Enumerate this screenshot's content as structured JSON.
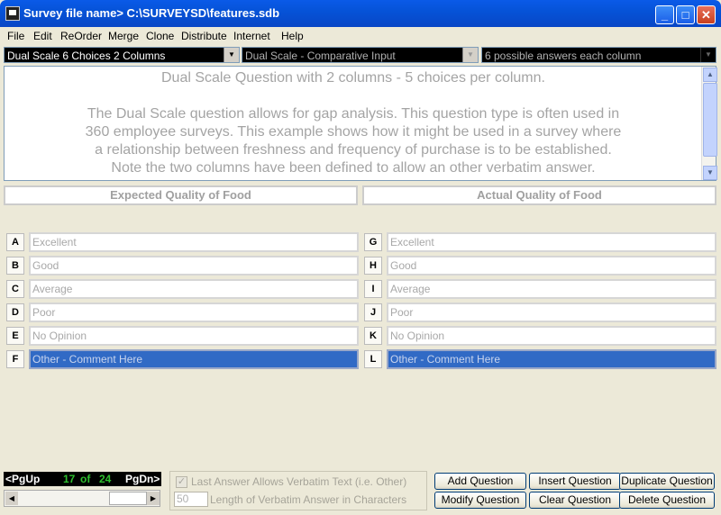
{
  "window": {
    "title": "Survey file name> C:\\SURVEYSD\\features.sdb",
    "minimize_glyph": "_",
    "maximize_glyph": "□",
    "close_glyph": "✕"
  },
  "menu": [
    "File",
    "Edit",
    "ReOrder",
    "Merge",
    "Clone",
    "Distribute",
    "Internet",
    "Help"
  ],
  "toolbar": {
    "question_select": "Dual Scale 6 Choices 2 Columns",
    "input_type_select": "Dual Scale - Comparative Input",
    "answers_select": "6 possible answers each column"
  },
  "question_text": {
    "lines": [
      "Dual Scale Question with 2 columns - 5 choices per column.",
      "",
      "The Dual Scale question allows for gap analysis. This question type is often used in",
      "360 employee surveys. This example shows how it might be used in a survey where",
      "a relationship between freshness and frequency of purchase is to be established.",
      "Note the two columns have been defined to allow an other verbatim answer."
    ]
  },
  "columns": [
    {
      "header": "Expected Quality of Food",
      "rows": [
        {
          "letter": "A",
          "text": "Excellent"
        },
        {
          "letter": "B",
          "text": "Good"
        },
        {
          "letter": "C",
          "text": "Average"
        },
        {
          "letter": "D",
          "text": "Poor"
        },
        {
          "letter": "E",
          "text": "No Opinion"
        },
        {
          "letter": "F",
          "text": "Other - Comment Here"
        }
      ]
    },
    {
      "header": "Actual Quality of Food",
      "rows": [
        {
          "letter": "G",
          "text": "Excellent"
        },
        {
          "letter": "H",
          "text": "Good"
        },
        {
          "letter": "I",
          "text": "Average"
        },
        {
          "letter": "J",
          "text": "Poor"
        },
        {
          "letter": "K",
          "text": "No Opinion"
        },
        {
          "letter": "L",
          "text": "Other - Comment Here"
        }
      ]
    }
  ],
  "pager": {
    "prev": "<PgUp",
    "current": "17",
    "of": "of",
    "total": "24",
    "next": "PgDn>"
  },
  "verbatim": {
    "checkbox_label": "Last Answer Allows Verbatim Text (i.e. Other)",
    "checked_glyph": "✓",
    "length_value": "50",
    "length_label": "Length of Verbatim Answer in Characters"
  },
  "buttons": {
    "add": "Add Question",
    "insert": "Insert Question",
    "duplicate": "Duplicate Question",
    "modify": "Modify Question",
    "clear": "Clear Question",
    "delete": "Delete Question"
  },
  "colors": {
    "title_bar": "#0653d8",
    "selected_row": "#316ac5",
    "pager_current": "#2ec02e"
  }
}
